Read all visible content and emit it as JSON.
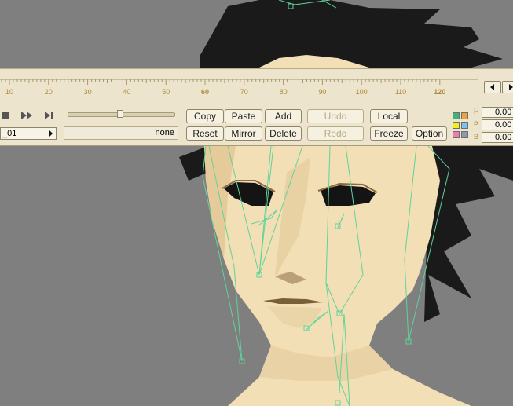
{
  "timeline": {
    "ticks": [
      "10",
      "20",
      "30",
      "40",
      "50",
      "60",
      "70",
      "80",
      "90",
      "100",
      "110",
      "120"
    ],
    "major_ticks": [
      "60",
      "120"
    ]
  },
  "transport": {
    "play_icon": "stop-icon",
    "fast_forward_icon": "fast-forward-icon",
    "next_icon": "skip-to-end-icon"
  },
  "clip": {
    "name": "_01",
    "value": "none"
  },
  "buttons": {
    "copy": "Copy",
    "paste": "Paste",
    "add": "Add",
    "undo": "Undo",
    "local": "Local",
    "reset": "Reset",
    "mirror": "Mirror",
    "delete": "Delete",
    "redo": "Redo",
    "freeze": "Freeze",
    "option": "Option"
  },
  "swatches": [
    "#3db57a",
    "#f2a03a",
    "#f0f020",
    "#7cc3f0",
    "#f07bb0",
    "#8a9ab4"
  ],
  "axes": [
    {
      "label": "H",
      "value": "0.00"
    },
    {
      "label": "P",
      "value": "0.00"
    },
    {
      "label": "B",
      "value": "0.00"
    }
  ],
  "colors": {
    "panel": "#ece4cc",
    "bone_overlay": "#5fd39a",
    "skin": "#f3dfb5",
    "hair": "#1a1a1a",
    "viewport_bg": "#7f7f7f"
  }
}
